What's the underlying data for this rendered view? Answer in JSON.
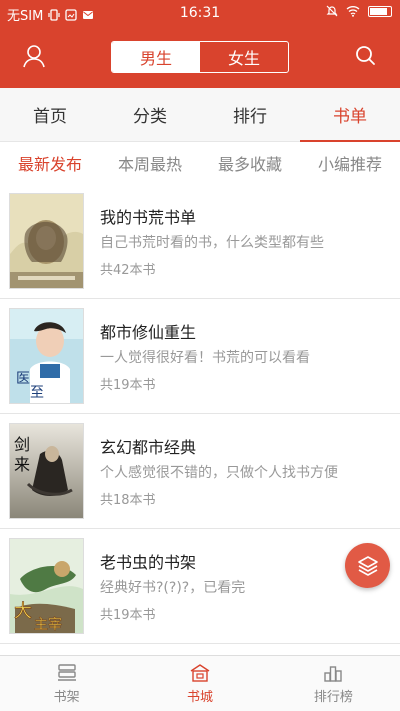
{
  "status_bar": {
    "carrier": "无SIM",
    "time": "16:31"
  },
  "header": {
    "gender_tabs": [
      "男生",
      "女生"
    ],
    "active_gender": "男生"
  },
  "main_tabs": [
    {
      "label": "首页",
      "active": false
    },
    {
      "label": "分类",
      "active": false
    },
    {
      "label": "排行",
      "active": false
    },
    {
      "label": "书单",
      "active": true
    }
  ],
  "sub_tabs": [
    {
      "label": "最新发布",
      "active": true
    },
    {
      "label": "本周最热",
      "active": false
    },
    {
      "label": "最多收藏",
      "active": false
    },
    {
      "label": "小编推荐",
      "active": false
    }
  ],
  "booklists": [
    {
      "title": "我的书荒书单",
      "desc": "自己书荒时看的书，什么类型都有些",
      "count": "共42本书"
    },
    {
      "title": "都市修仙重生",
      "desc": "一人觉得很好看！书荒的可以看看",
      "count": "共19本书"
    },
    {
      "title": "玄幻都市经典",
      "desc": "个人感觉很不错的，只做个人找书方便",
      "count": "共18本书"
    },
    {
      "title": "老书虫的书架",
      "desc": "经典好书?(?)?，已看完",
      "count": "共19本书"
    }
  ],
  "bottom_nav": [
    {
      "label": "书架",
      "active": false
    },
    {
      "label": "书城",
      "active": true
    },
    {
      "label": "排行榜",
      "active": false
    }
  ],
  "colors": {
    "brand": "#d9432d",
    "fab": "#e15a45"
  }
}
